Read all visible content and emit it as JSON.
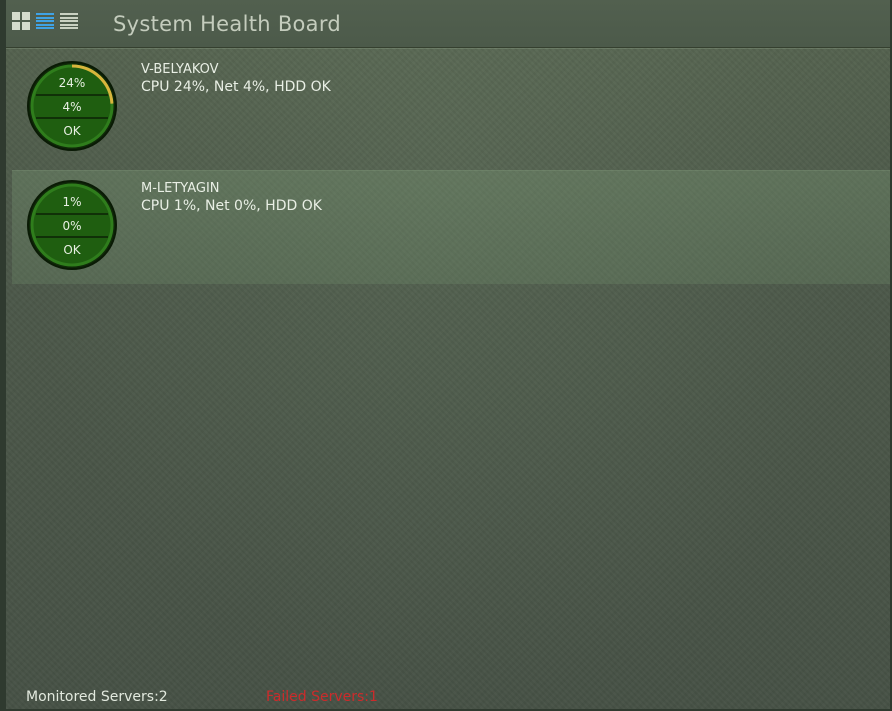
{
  "header": {
    "title": "System Health Board",
    "view_icons": [
      "tiles-view-icon",
      "list-view-icon",
      "details-view-icon"
    ],
    "active_view": "list-view-icon"
  },
  "colors": {
    "accent_blue": "#3fa3e6",
    "gauge_green": "#1f5e10",
    "cpu_arc_yellow": "#d8b53c",
    "failed_red": "#cc2b2b"
  },
  "servers": [
    {
      "name": "V-BELYAKOV",
      "stats": "CPU 24%, Net 4%, HDD OK",
      "gauge": {
        "cpu": "24%",
        "net": "4%",
        "hdd": "OK"
      },
      "cpu_value": 24
    },
    {
      "name": "M-LETYAGIN",
      "stats": "CPU 1%, Net 0%, HDD OK",
      "gauge": {
        "cpu": "1%",
        "net": "0%",
        "hdd": "OK"
      },
      "cpu_value": 1
    }
  ],
  "footer": {
    "monitored": "Monitored Servers:2",
    "failed": "Failed Servers:1"
  }
}
